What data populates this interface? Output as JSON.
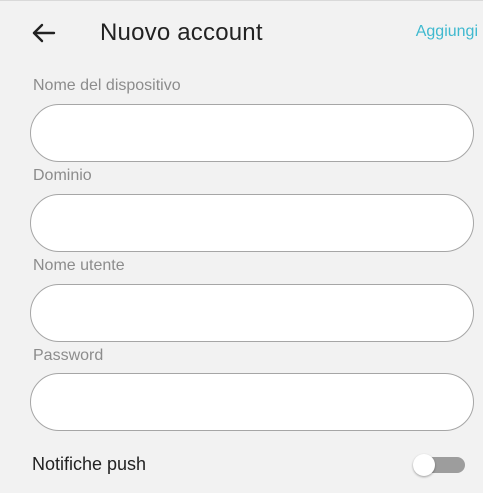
{
  "header": {
    "back_icon": "arrow-left-icon",
    "title": "Nuovo account",
    "action_label": "Aggiungi",
    "action_color": "#3fb9cf"
  },
  "form": {
    "device_name": {
      "label": "Nome del dispositivo",
      "value": ""
    },
    "domain": {
      "label": "Dominio",
      "value": ""
    },
    "username": {
      "label": "Nome utente",
      "value": ""
    },
    "password": {
      "label": "Password",
      "value": ""
    }
  },
  "push": {
    "label": "Notifiche push",
    "enabled": false
  }
}
